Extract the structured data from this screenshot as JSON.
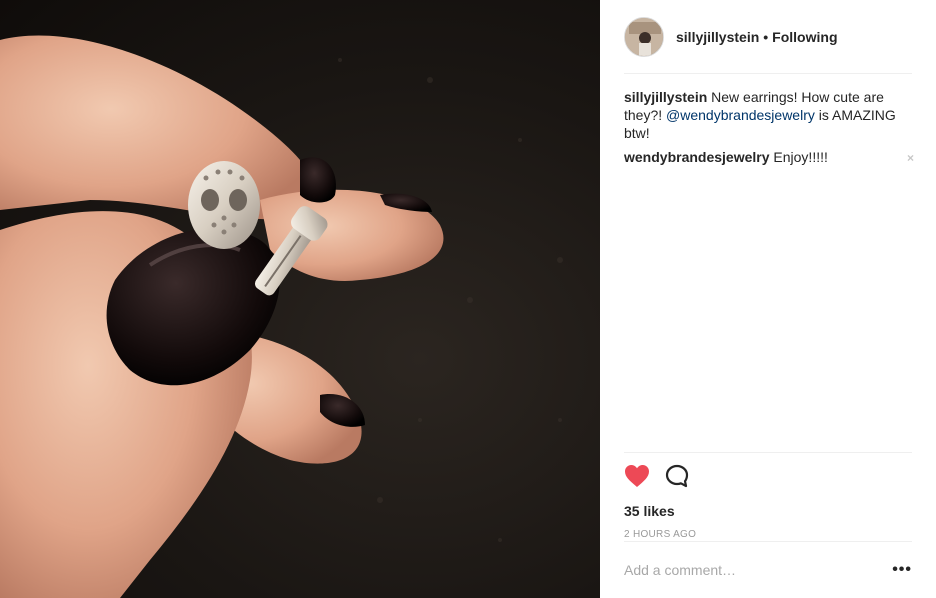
{
  "post": {
    "author": "sillyjillystein",
    "follow_status": "Following",
    "separator": "•"
  },
  "comments": [
    {
      "user": "sillyjillystein",
      "text_before": "New earrings! How cute are they?! ",
      "mention": "@wendybrandesjewelry",
      "text_after": " is AMAZING btw!"
    },
    {
      "user": "wendybrandesjewelry",
      "text": "Enjoy!!!!!",
      "remove_label": "×"
    }
  ],
  "actions": {
    "liked": true,
    "likes_label": "35 likes",
    "timestamp": "2 HOURS AGO",
    "heart_icon": "heart-filled-icon",
    "comment_icon": "comment-bubble-icon",
    "heart_color": "#ed4956"
  },
  "add_comment": {
    "placeholder": "Add a comment…",
    "more_label": "•••"
  }
}
